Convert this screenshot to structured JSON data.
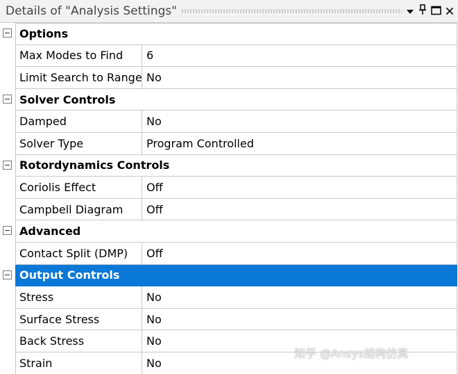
{
  "window": {
    "title": "Details of \"Analysis Settings\"",
    "icons": [
      "dropdown-arrow-icon",
      "pin-icon",
      "maximize-icon",
      "close-icon"
    ]
  },
  "groups": [
    {
      "label": "Options",
      "rows": [
        {
          "name": "Max Modes to Find",
          "value": "6"
        },
        {
          "name": "Limit Search to Range",
          "value": "No"
        }
      ]
    },
    {
      "label": "Solver Controls",
      "rows": [
        {
          "name": "Damped",
          "value": "No"
        },
        {
          "name": "Solver Type",
          "value": "Program Controlled"
        }
      ]
    },
    {
      "label": "Rotordynamics Controls",
      "rows": [
        {
          "name": "Coriolis Effect",
          "value": "Off"
        },
        {
          "name": "Campbell Diagram",
          "value": "Off"
        }
      ]
    },
    {
      "label": "Advanced",
      "rows": [
        {
          "name": "Contact Split (DMP)",
          "value": "Off"
        }
      ]
    },
    {
      "label": "Output Controls",
      "selected": true,
      "rows": [
        {
          "name": "Stress",
          "value": "No"
        },
        {
          "name": "Surface Stress",
          "value": "No"
        },
        {
          "name": "Back Stress",
          "value": "No"
        },
        {
          "name": "Strain",
          "value": "No"
        }
      ]
    }
  ],
  "colors": {
    "selection": "#0a78d7",
    "grid_line": "#c8c8c8",
    "title_bar": "#f2f2f2"
  },
  "watermark": "知乎 @Ansys结构仿真"
}
